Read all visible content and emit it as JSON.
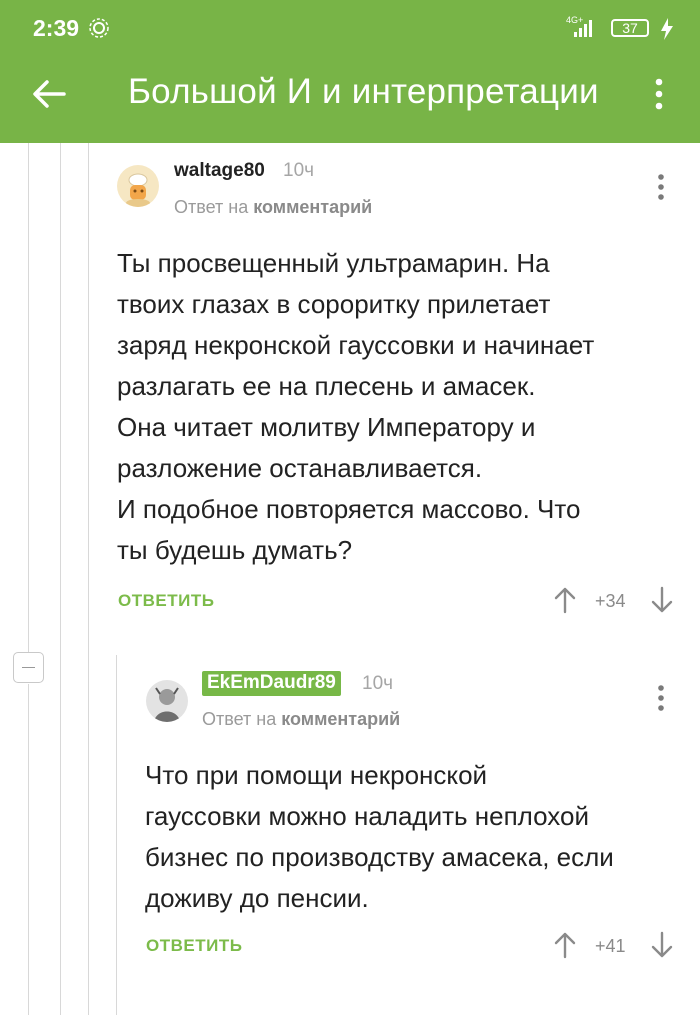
{
  "status_bar": {
    "time": "2:39",
    "network": "4G+",
    "battery": "37"
  },
  "app_bar": {
    "title": "Большой И и интерпретации"
  },
  "comments": [
    {
      "username": "waltage80",
      "time": "10ч",
      "reply_prefix": "Ответ на",
      "reply_target": "комментарий",
      "text": "Ты просвещенный ультрамарин. На\nтвоих глазах в сороритку прилетает\nзаряд некронской гауссовки и начинает\nразлагать ее на плесень и амасек.\nОна читает молитву Императору и\nразложение останавливается.\nИ подобное повторяется массово. Что\nты будешь думать?",
      "reply_label": "ОТВЕТИТЬ",
      "score": "+34"
    },
    {
      "username": "EkEmDaudr89",
      "time": "10ч",
      "reply_prefix": "Ответ на",
      "reply_target": "комментарий",
      "text": "Что при помощи некронской\nгауссовки можно наладить неплохой\nбизнес по производству амасека, если\nдоживу до пенсии.",
      "reply_label": "ОТВЕТИТЬ",
      "score": "+41"
    }
  ],
  "colors": {
    "accent": "#78b447",
    "link_green": "#7cbb4a",
    "muted": "#9a9a9a"
  },
  "icons": [
    "back-arrow-icon",
    "more-vert-icon",
    "arrow-up-icon",
    "arrow-down-icon",
    "collapse-icon"
  ]
}
